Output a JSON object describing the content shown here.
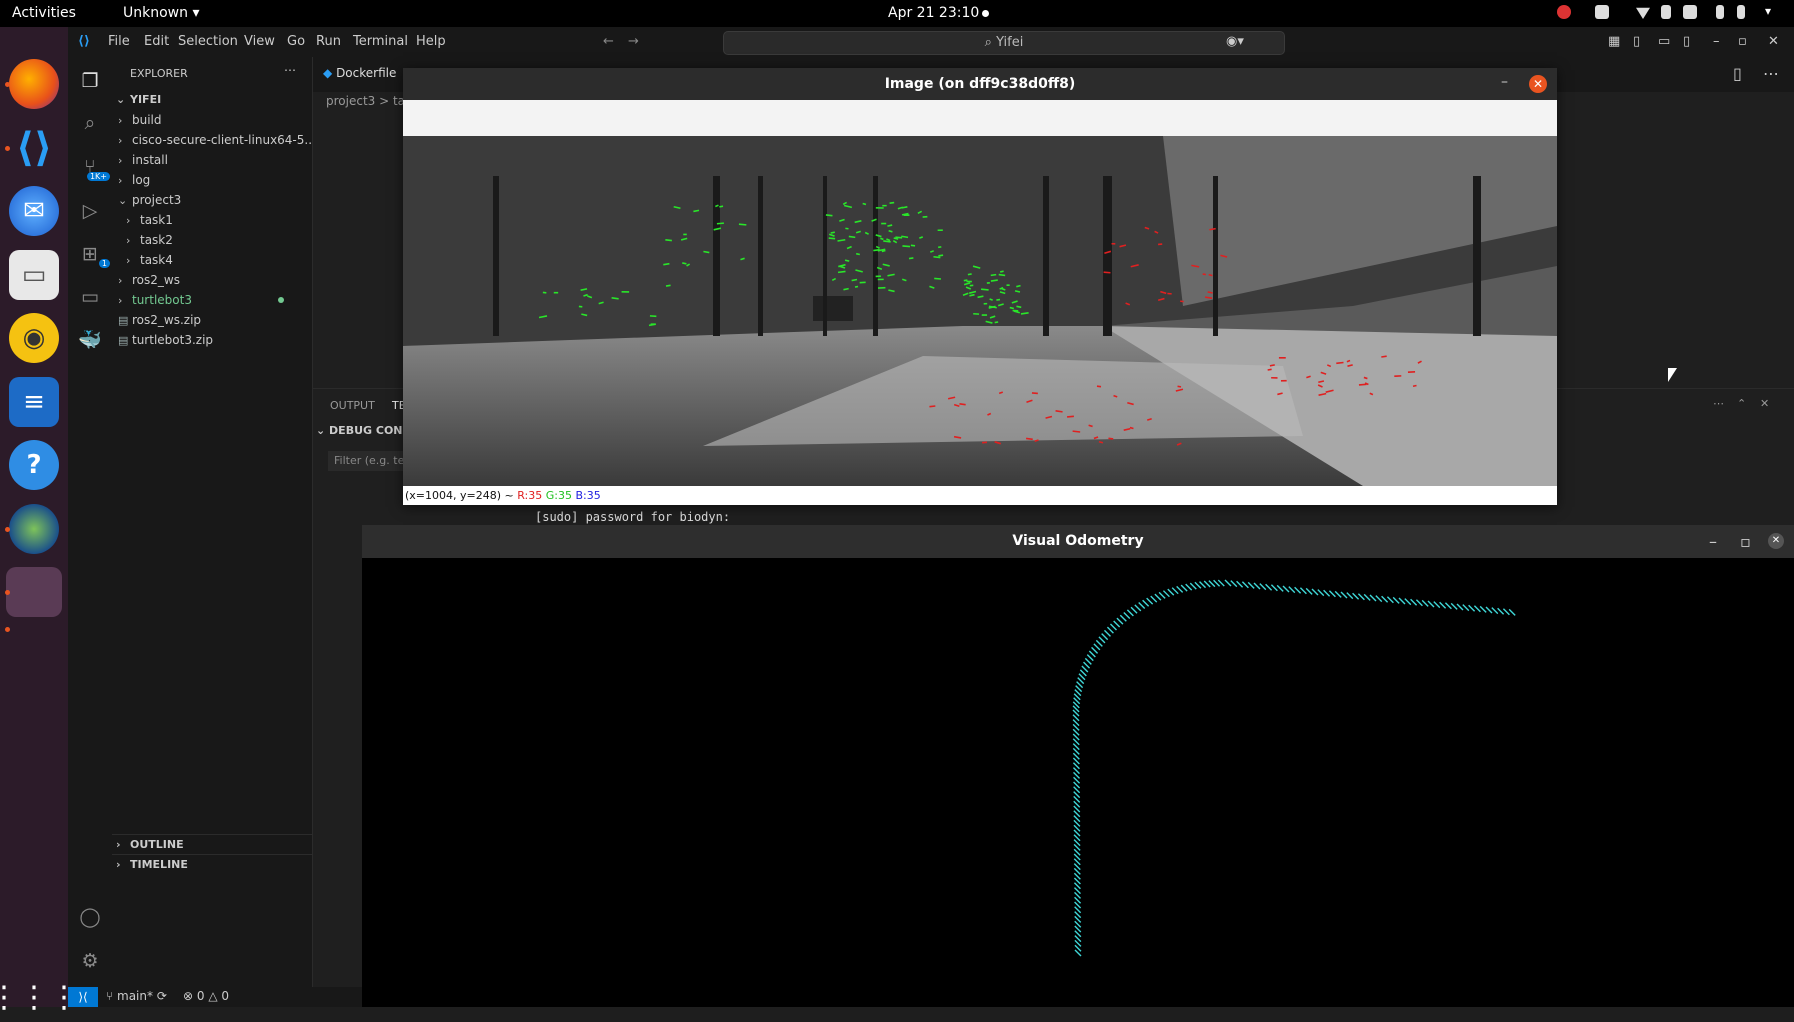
{
  "topbar": {
    "activities": "Activities",
    "app_menu": "Unknown",
    "clock": "Apr 21  23:10"
  },
  "dock": {
    "items": [
      "firefox-icon",
      "vscode-icon",
      "thunderbird-icon",
      "files-icon",
      "rhythmbox-icon",
      "writer-icon",
      "help-icon",
      "globe-icon",
      "blank-app-icon"
    ],
    "apps_grid": "apps-grid-icon"
  },
  "vscode": {
    "menu": [
      "File",
      "Edit",
      "Selection",
      "View",
      "Go",
      "Run",
      "Terminal",
      "Help"
    ],
    "search": "Yifei",
    "explorer_title": "EXPLORER",
    "root": "YIFEI",
    "tree": [
      {
        "label": "build",
        "indent": 0,
        "type": "folder"
      },
      {
        "label": "cisco-secure-client-linux64-5...",
        "indent": 0,
        "type": "folder"
      },
      {
        "label": "install",
        "indent": 0,
        "type": "folder"
      },
      {
        "label": "log",
        "indent": 0,
        "type": "folder"
      },
      {
        "label": "project3",
        "indent": 0,
        "type": "folder-open"
      },
      {
        "label": "task1",
        "indent": 1,
        "type": "folder"
      },
      {
        "label": "task2",
        "indent": 1,
        "type": "folder"
      },
      {
        "label": "task4",
        "indent": 1,
        "type": "folder"
      },
      {
        "label": "ros2_ws",
        "indent": 0,
        "type": "folder"
      },
      {
        "label": "turtlebot3",
        "indent": 0,
        "type": "folder-modified"
      },
      {
        "label": "ros2_ws.zip",
        "indent": 0,
        "type": "file"
      },
      {
        "label": "turtlebot3.zip",
        "indent": 0,
        "type": "file"
      }
    ],
    "tab": "Dockerfile",
    "breadcrumb": "project3 > ta",
    "panel_tabs": [
      "OUTPUT",
      "TE"
    ],
    "debug_console": "DEBUG CONSO",
    "filter_placeholder": "Filter (e.g. te",
    "outline": "OUTLINE",
    "timeline": "TIMELINE",
    "status_branch": "main*",
    "status_problems": "0 △ 0",
    "terminal_line": "[sudo] password for biodyn:"
  },
  "image_window": {
    "title": "Image (on dff9c38d0ff8)",
    "status_coords": "(x=1004, y=248) ~",
    "r": "R:35",
    "g": "G:35",
    "b": "B:35"
  },
  "vo_window": {
    "title": "Visual Odometry"
  },
  "colors": {
    "trajectory": "#3fd6d6",
    "feature_green": "#29e629",
    "feature_red": "#e02020",
    "accent": "#0078d4"
  }
}
